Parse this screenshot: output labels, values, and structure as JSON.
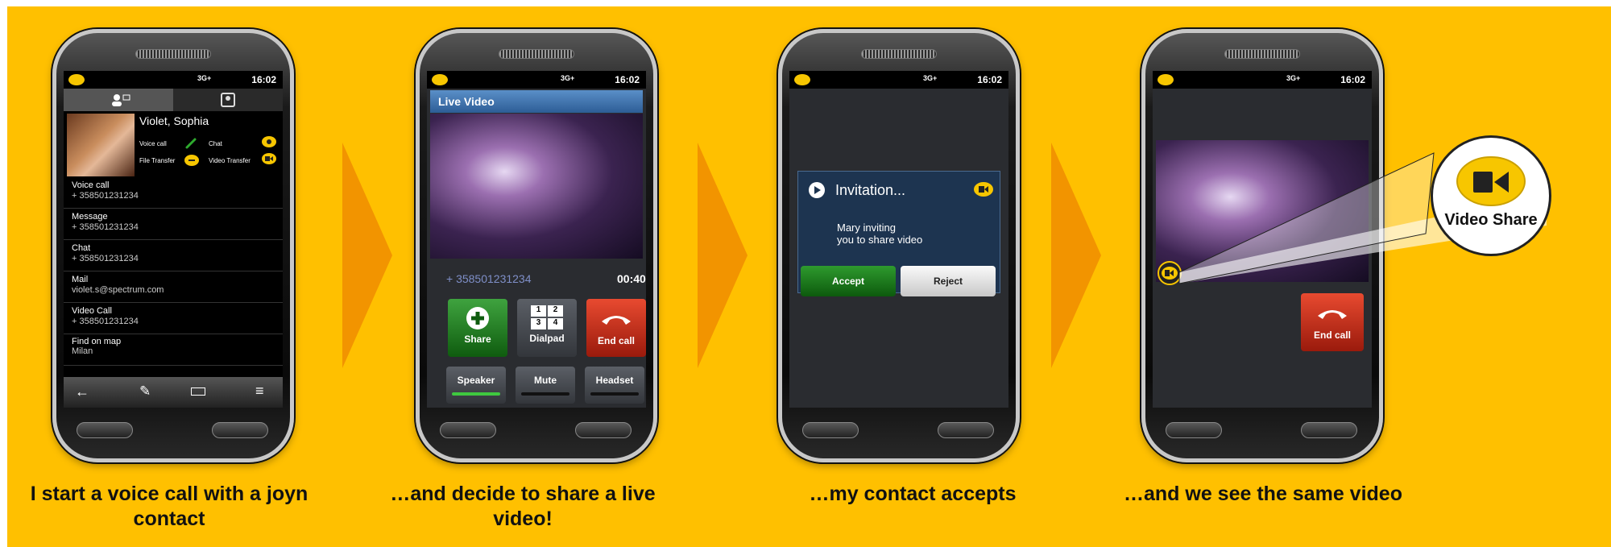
{
  "status": {
    "network": "3G+",
    "time": "16:02"
  },
  "phone1": {
    "contact_name": "Violet, Sophia",
    "caps": {
      "voice": "Voice call",
      "chat": "Chat",
      "file": "File Transfer",
      "video": "Video Transfer"
    },
    "rows": [
      {
        "label": "Voice call",
        "value": "+ 358501231234"
      },
      {
        "label": "Message",
        "value": "+ 358501231234"
      },
      {
        "label": "Chat",
        "value": "+ 358501231234"
      },
      {
        "label": "Mail",
        "value": "violet.s@spectrum.com"
      },
      {
        "label": "Video Call",
        "value": "+ 358501231234"
      },
      {
        "label": "Find on map",
        "value": "Milan"
      }
    ]
  },
  "phone2": {
    "title": "Live Video",
    "number": "+ 358501231234",
    "duration": "00:40",
    "share": "Share",
    "dialpad": "Dialpad",
    "dial_keys": [
      "1",
      "2",
      "3",
      "4"
    ],
    "end": "End call",
    "speaker": "Speaker",
    "mute": "Mute",
    "headset": "Headset"
  },
  "phone3": {
    "title": "Invitation...",
    "message_line1": "Mary inviting",
    "message_line2": "you to share video",
    "accept": "Accept",
    "reject": "Reject"
  },
  "phone4": {
    "end": "End call",
    "callout": "Video Share"
  },
  "captions": {
    "c1": "I start a voice call with a joyn contact",
    "c2": "…and decide to share a live video!",
    "c3": "…my contact accepts",
    "c4": "…and we see the same video"
  },
  "colors": {
    "background": "#ffc000",
    "arrow": "#f29400",
    "green": "#1a7a1a",
    "red": "#c0281a",
    "accent": "#f7c600"
  }
}
